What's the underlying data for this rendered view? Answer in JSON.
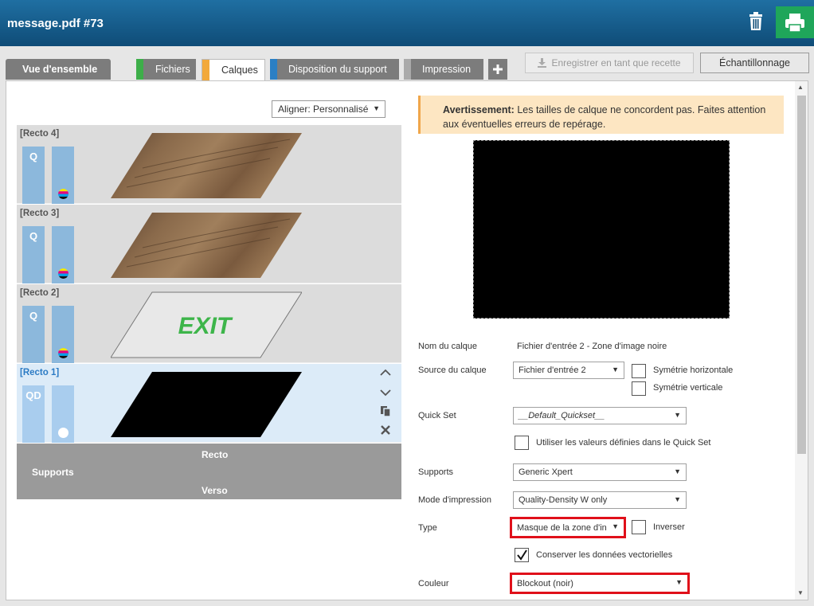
{
  "window": {
    "title": "message.pdf #73"
  },
  "tabs": [
    {
      "label": "Vue d'ensemble"
    },
    {
      "label": "Fichiers",
      "color": "#3dae49"
    },
    {
      "label": "Calques",
      "color": "#f2a93b"
    },
    {
      "label": "Disposition du support",
      "color": "#2b7fc4"
    },
    {
      "label": "Impression",
      "color": "#aaaaaa"
    }
  ],
  "toolbar": {
    "save_recipe": "Enregistrer en tant que recette",
    "sampling": "Échantillonnage"
  },
  "layers_panel": {
    "align_select": "Aligner: Personnalisé",
    "layers": [
      {
        "name": "[Recto 4]",
        "col1": "Q"
      },
      {
        "name": "[Recto 3]",
        "col1": "Q"
      },
      {
        "name": "[Recto 2]",
        "col1": "Q",
        "thumb_text": "EXIT"
      },
      {
        "name": "[Recto 1]",
        "col1": "QD"
      }
    ],
    "supports": {
      "label": "Supports",
      "recto": "Recto",
      "verso": "Verso"
    }
  },
  "details": {
    "warning_bold": "Avertissement:",
    "warning_text": " Les tailles de calque ne concordent pas. Faites attention aux éventuelles erreurs de repérage.",
    "layer_name_label": "Nom du calque",
    "layer_name_value": "Fichier d'entrée 2 - Zone d'image noire",
    "layer_source_label": "Source du calque",
    "layer_source_value": "Fichier d'entrée 2",
    "mirror_h": "Symétrie horizontale",
    "mirror_v": "Symétrie verticale",
    "quickset_label": "Quick Set",
    "quickset_value": "__Default_Quickset__",
    "use_quickset": "Utiliser les valeurs définies dans le Quick Set",
    "media_label": "Supports",
    "media_value": "Generic Xpert",
    "print_mode_label": "Mode d'impression",
    "print_mode_value": "Quality-Density W only",
    "type_label": "Type",
    "type_value": "Masque de la zone d'in",
    "invert_label": "Inverser",
    "keep_vector": "Conserver les données vectorielles",
    "color_label": "Couleur",
    "color_value": "Blockout (noir)"
  },
  "colors": {
    "accent_blue": "#2c7bc4",
    "print_green": "#1fa65a",
    "highlight_red": "#e0101a"
  }
}
